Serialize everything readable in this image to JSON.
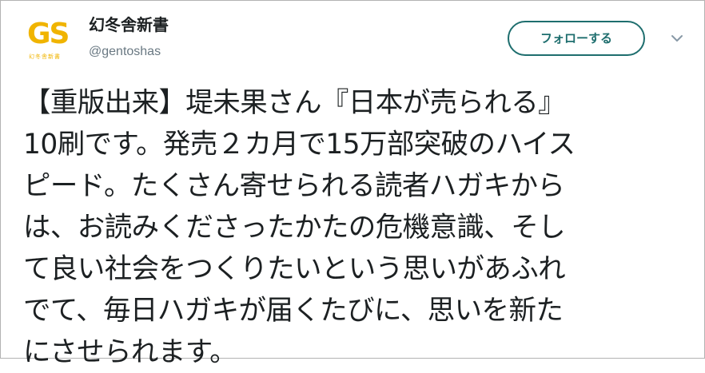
{
  "account": {
    "avatar_mark": "GS",
    "avatar_sub": "幻冬舎新書",
    "display_name": "幻冬舎新書",
    "handle": "@gentoshas"
  },
  "follow_button": {
    "label": "フォローする"
  },
  "menu": {
    "icon": "chevron-down-icon"
  },
  "tweet": {
    "lines": [
      "【重版出来】堤未果さん『日本が売られる』",
      "10刷です。発売２カ月で15万部突破のハイス",
      "ピード。たくさん寄せられる読者ハガキから",
      "は、お読みくださったかたの危機意識、そし",
      "て良い社会をつくりたいという思いがあふれ",
      "でて、毎日ハガキが届くたびに、思いを新た",
      "にさせられます。"
    ]
  },
  "colors": {
    "accent": "#1e6e6e",
    "avatar_gold": "#f0b400",
    "text": "#1c2022",
    "muted": "#697882",
    "border": "#b3b3b3"
  }
}
